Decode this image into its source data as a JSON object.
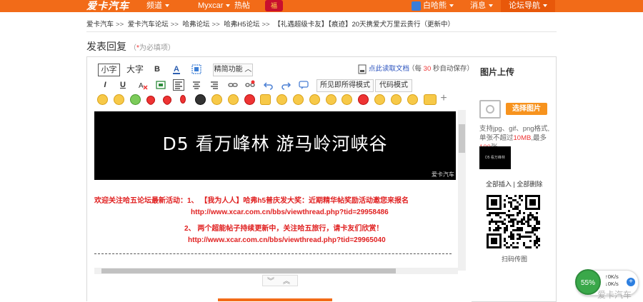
{
  "topbar": {
    "logo": "爱卡汽车",
    "nav": [
      "频道",
      "Myxcar",
      "热帖"
    ],
    "festival_badge": "福",
    "user_name": "白哈熊",
    "messages": "消息",
    "forum_nav": "论坛导航"
  },
  "breadcrumb": [
    "爱卡汽车",
    "爱卡汽车论坛",
    "哈弗论坛",
    "哈弗H5论坛",
    "【礼遇超级卡友】【痕迹】20天携爱犬万里云贵行（更新中）"
  ],
  "page_title": "发表回复",
  "required_hint": "为必填项",
  "required_star": "*",
  "toolbar": {
    "small_font": "小字",
    "large_font": "大字",
    "bold": "B",
    "italic": "I",
    "underline": "U",
    "simple_mode": "精简功能",
    "load_draft": "点此读取文档",
    "autosave_prefix": "每",
    "autosave_num": "30",
    "autosave_suffix": "秒自动保存",
    "wysiwyg": "所见即所得模式",
    "code_mode": "代码模式"
  },
  "content": {
    "banner_title": "D5  看万峰林  游马岭河峡谷",
    "banner_watermark": "爱卡汽车",
    "line1": "欢迎关注哈五论坛最新活动：1、 【我为人人】哈弗h5普庆发大奖：近期精华帖奖励活动邀您来报名",
    "line2": "http://www.xcar.com.cn/bbs/viewthread.php?tid=29958486",
    "line3": "2、  两个超能帖子持续更新中，关注哈五旅行，请卡友们欣赏！",
    "line4": "http://www.xcar.com.cn/bbs/viewthread.php?tid=29965040"
  },
  "sidebar": {
    "title": "图片上传",
    "choose_button": "选择图片",
    "hint_prefix": "支持jpg、gif、png格式,单张不超过",
    "hint_size": "10MB",
    "hint_mid": ",最多",
    "hint_count": "100",
    "hint_suffix": "张",
    "thumb_text": "D5 看万峰林",
    "insert_all": "全部插入",
    "delete_all": "全部删除",
    "qr_label": "扫码传图"
  },
  "speed": {
    "percent": "55%",
    "up": "0K/s",
    "down": "0K/s",
    "plus": "+"
  },
  "corner_watermark": "爱卡汽车"
}
